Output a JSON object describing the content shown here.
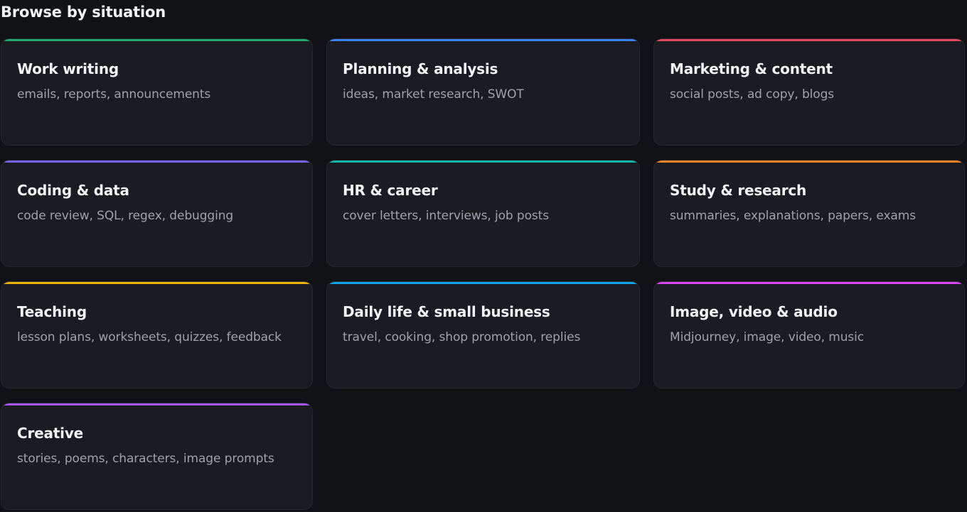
{
  "section": {
    "title": "Browse by situation"
  },
  "cards": [
    {
      "title": "Work writing",
      "desc": "emails, reports, announcements",
      "accent": "#1fa96b"
    },
    {
      "title": "Planning & analysis",
      "desc": "ideas, market research, SWOT",
      "accent": "#3b82f6"
    },
    {
      "title": "Marketing & content",
      "desc": "social posts, ad copy, blogs",
      "accent": "#e5485f"
    },
    {
      "title": "Coding & data",
      "desc": "code review, SQL, regex, debugging",
      "accent": "#7664e8"
    },
    {
      "title": "HR & career",
      "desc": "cover letters, interviews, job posts",
      "accent": "#14b8a6"
    },
    {
      "title": "Study & research",
      "desc": "summaries, explanations, papers, exams",
      "accent": "#f0822a"
    },
    {
      "title": "Teaching",
      "desc": "lesson plans, worksheets, quizzes, feedback",
      "accent": "#eab308"
    },
    {
      "title": "Daily life & small business",
      "desc": "travel, cooking, shop promotion, replies",
      "accent": "#0ea5e9"
    },
    {
      "title": "Image, video & audio",
      "desc": "Midjourney, image, video, music",
      "accent": "#d946ef"
    },
    {
      "title": "Creative",
      "desc": "stories, poems, characters, image prompts",
      "accent": "#a855f7"
    }
  ]
}
